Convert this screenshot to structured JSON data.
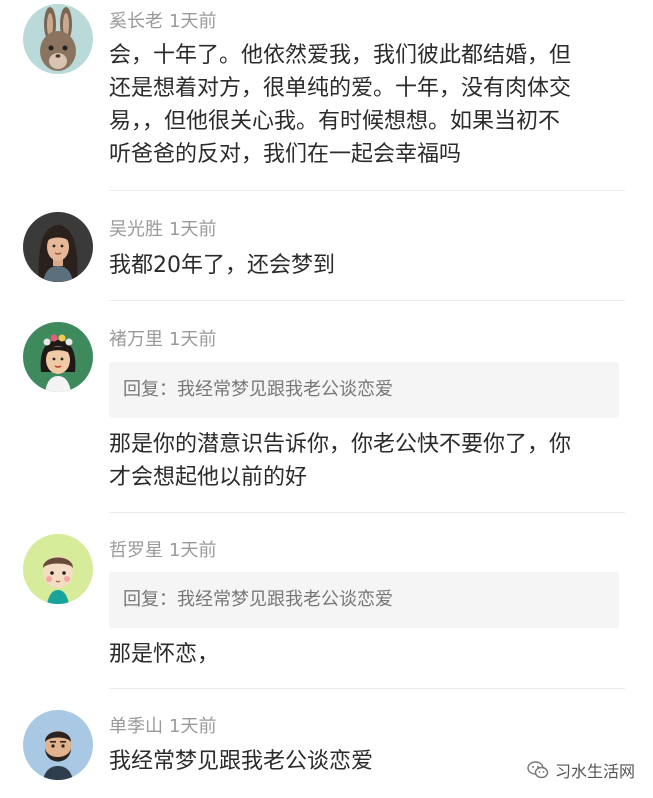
{
  "comments": [
    {
      "username": "奚长老",
      "time": "1天前",
      "avatar": "rabbit-avatar",
      "lines": [
        "会，十年了。他依然爱我，我们彼此都结婚，但",
        "还是想着对方，很单纯的爱。十年，没有肉体交",
        "易，，但他很关心我。有时候想想。如果当初不",
        "听爸爸的反对，我们在一起会幸福吗"
      ]
    },
    {
      "username": "吴光胜",
      "time": "1天前",
      "avatar": "woman-long-hair-avatar",
      "lines": [
        "我都20年了，还会梦到"
      ]
    },
    {
      "username": "褚万里",
      "time": "1天前",
      "avatar": "flower-crown-woman-avatar",
      "reply": "回复：我经常梦见跟我老公谈恋爱",
      "lines": [
        "那是你的潜意识告诉你，你老公快不要你了，你",
        "才会想起他以前的好"
      ]
    },
    {
      "username": "哲罗星",
      "time": "1天前",
      "avatar": "baby-avatar",
      "reply": "回复：我经常梦见跟我老公谈恋爱",
      "lines": [
        "那是怀恋，"
      ]
    },
    {
      "username": "单季山",
      "time": "1天前",
      "avatar": "bearded-man-avatar",
      "lines": [
        "我经常梦见跟我老公谈恋爱"
      ]
    }
  ],
  "watermark": {
    "text": "习水生活网",
    "icon": "wechat-icon"
  },
  "colors": {
    "username": "#9a9a9a",
    "text": "#2b2b2b",
    "reply_bg": "#f5f5f5",
    "divider": "#ececec"
  }
}
